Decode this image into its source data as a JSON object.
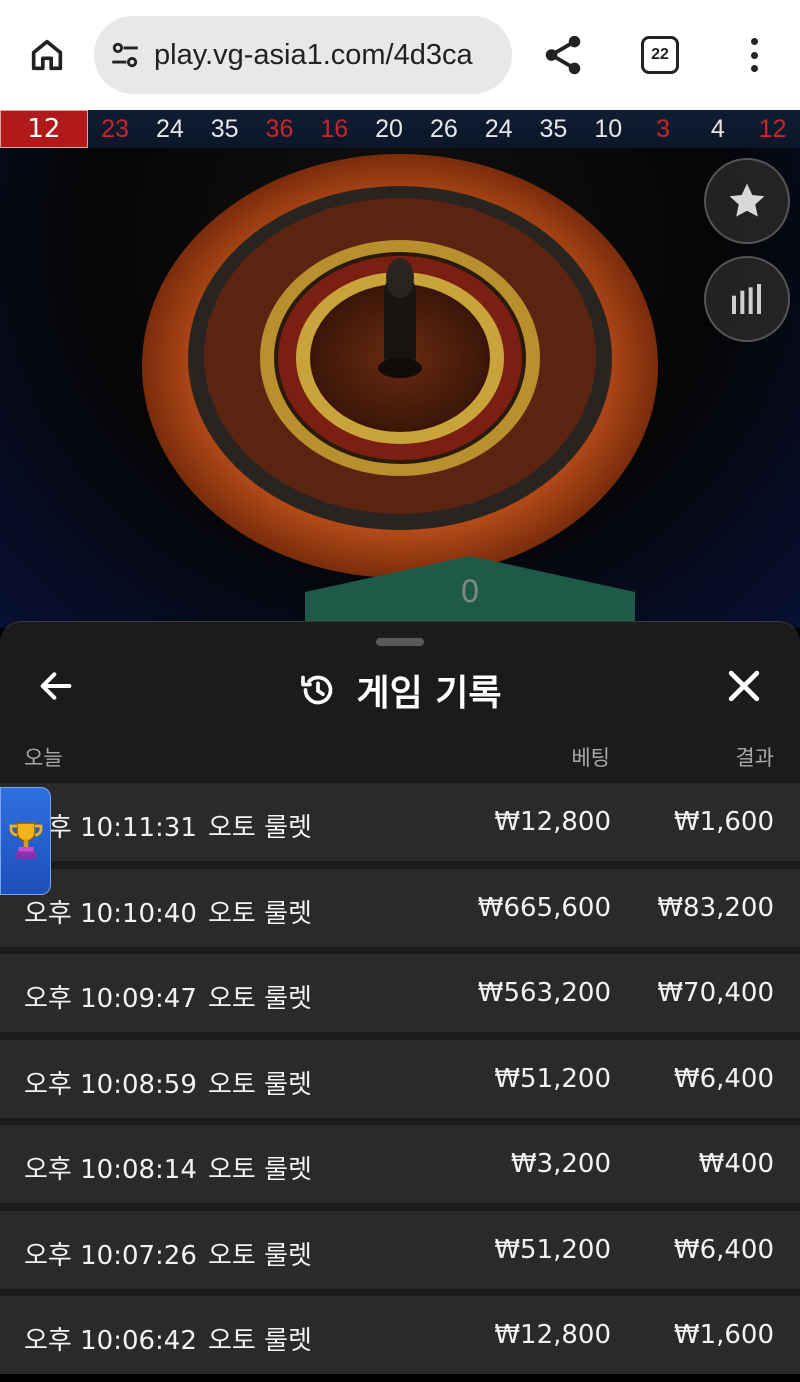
{
  "browser": {
    "url": "play.vg-asia1.com/4d3ca",
    "tab_count": "22",
    "icons": [
      "home-icon",
      "site-settings-icon",
      "share-icon",
      "tabs-icon",
      "more-vert-icon"
    ]
  },
  "history_strip": {
    "numbers": [
      {
        "value": "12",
        "color": "red"
      },
      {
        "value": "23",
        "color": "red"
      },
      {
        "value": "24",
        "color": "white"
      },
      {
        "value": "35",
        "color": "white"
      },
      {
        "value": "36",
        "color": "red"
      },
      {
        "value": "16",
        "color": "red"
      },
      {
        "value": "20",
        "color": "white"
      },
      {
        "value": "26",
        "color": "white"
      },
      {
        "value": "24",
        "color": "white"
      },
      {
        "value": "35",
        "color": "white"
      },
      {
        "value": "10",
        "color": "white"
      },
      {
        "value": "3",
        "color": "red"
      },
      {
        "value": "4",
        "color": "white"
      },
      {
        "value": "12",
        "color": "red"
      }
    ]
  },
  "stage": {
    "result_value": "0",
    "icons": [
      "star-icon",
      "bar-chart-icon"
    ]
  },
  "sheet": {
    "title": "게임 기록",
    "icons": [
      "back-arrow-icon",
      "history-icon",
      "close-icon"
    ],
    "columns": {
      "date": "오늘",
      "bet": "베팅",
      "result": "결과"
    },
    "rows": [
      {
        "time": "오후 10:11:31",
        "game": "오토 룰렛",
        "bet": "₩12,800",
        "result": "₩1,600"
      },
      {
        "time": "오후 10:10:40",
        "game": "오토 룰렛",
        "bet": "₩665,600",
        "result": "₩83,200"
      },
      {
        "time": "오후 10:09:47",
        "game": "오토 룰렛",
        "bet": "₩563,200",
        "result": "₩70,400"
      },
      {
        "time": "오후 10:08:59",
        "game": "오토 룰렛",
        "bet": "₩51,200",
        "result": "₩6,400"
      },
      {
        "time": "오후 10:08:14",
        "game": "오토 룰렛",
        "bet": "₩3,200",
        "result": "₩400"
      },
      {
        "time": "오후 10:07:26",
        "game": "오토 룰렛",
        "bet": "₩51,200",
        "result": "₩6,400"
      },
      {
        "time": "오후 10:06:42",
        "game": "오토 룰렛",
        "bet": "₩12,800",
        "result": "₩1,600"
      }
    ]
  },
  "promo": {
    "icon": "trophy-icon"
  },
  "colors": {
    "red_number": "#c8262b",
    "sheet_bg": "#1b1b1b",
    "row_bg": "#2a2a2a",
    "result_tab": "#1f5a48"
  }
}
